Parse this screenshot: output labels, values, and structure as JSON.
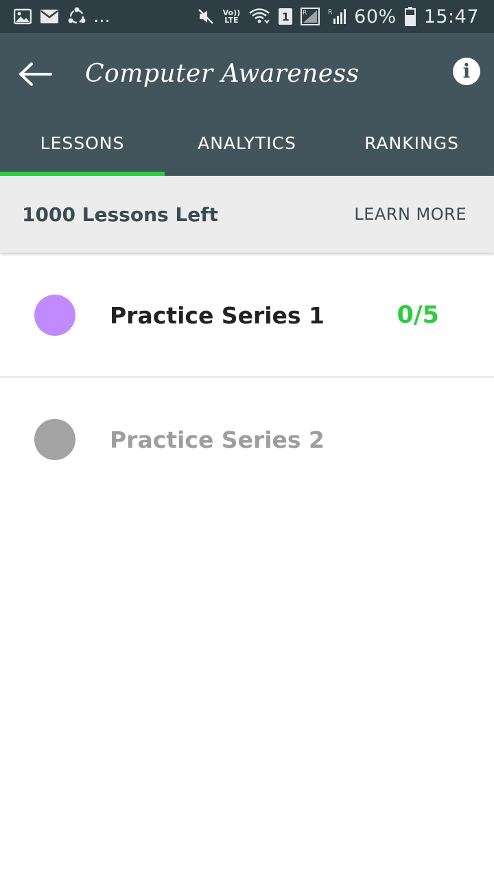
{
  "status_bar": {
    "left_icons": [
      "image-icon",
      "mail-icon",
      "share-icon"
    ],
    "overflow": "...",
    "volte_line1": "Vo))",
    "volte_line2": "LTE",
    "sim_badge": "1",
    "battery": "60%",
    "time": "15:47"
  },
  "header": {
    "title": "Computer Awareness",
    "back_icon": "arrow-left-icon",
    "info_icon": "info-icon",
    "info_glyph": "i"
  },
  "tabs": [
    {
      "label": "LESSONS",
      "active": true
    },
    {
      "label": "ANALYTICS",
      "active": false
    },
    {
      "label": "RANKINGS",
      "active": false
    }
  ],
  "banner": {
    "text": "1000 Lessons Left",
    "action": "LEARN MORE"
  },
  "lessons": [
    {
      "name": "Practice Series 1",
      "progress": "0/5",
      "dot_color": "#c18aff",
      "text_color": "#222222",
      "progress_color": "#2ecc40"
    },
    {
      "name": "Practice Series 2",
      "progress": "",
      "dot_color": "#a3a3a3",
      "text_color": "#9e9e9e",
      "progress_color": "#9e9e9e"
    }
  ],
  "colors": {
    "status_bar": "#2f3e45",
    "app_bar": "#42555d",
    "tab_indicator": "#2ecc40",
    "banner_bg": "#ececec"
  }
}
